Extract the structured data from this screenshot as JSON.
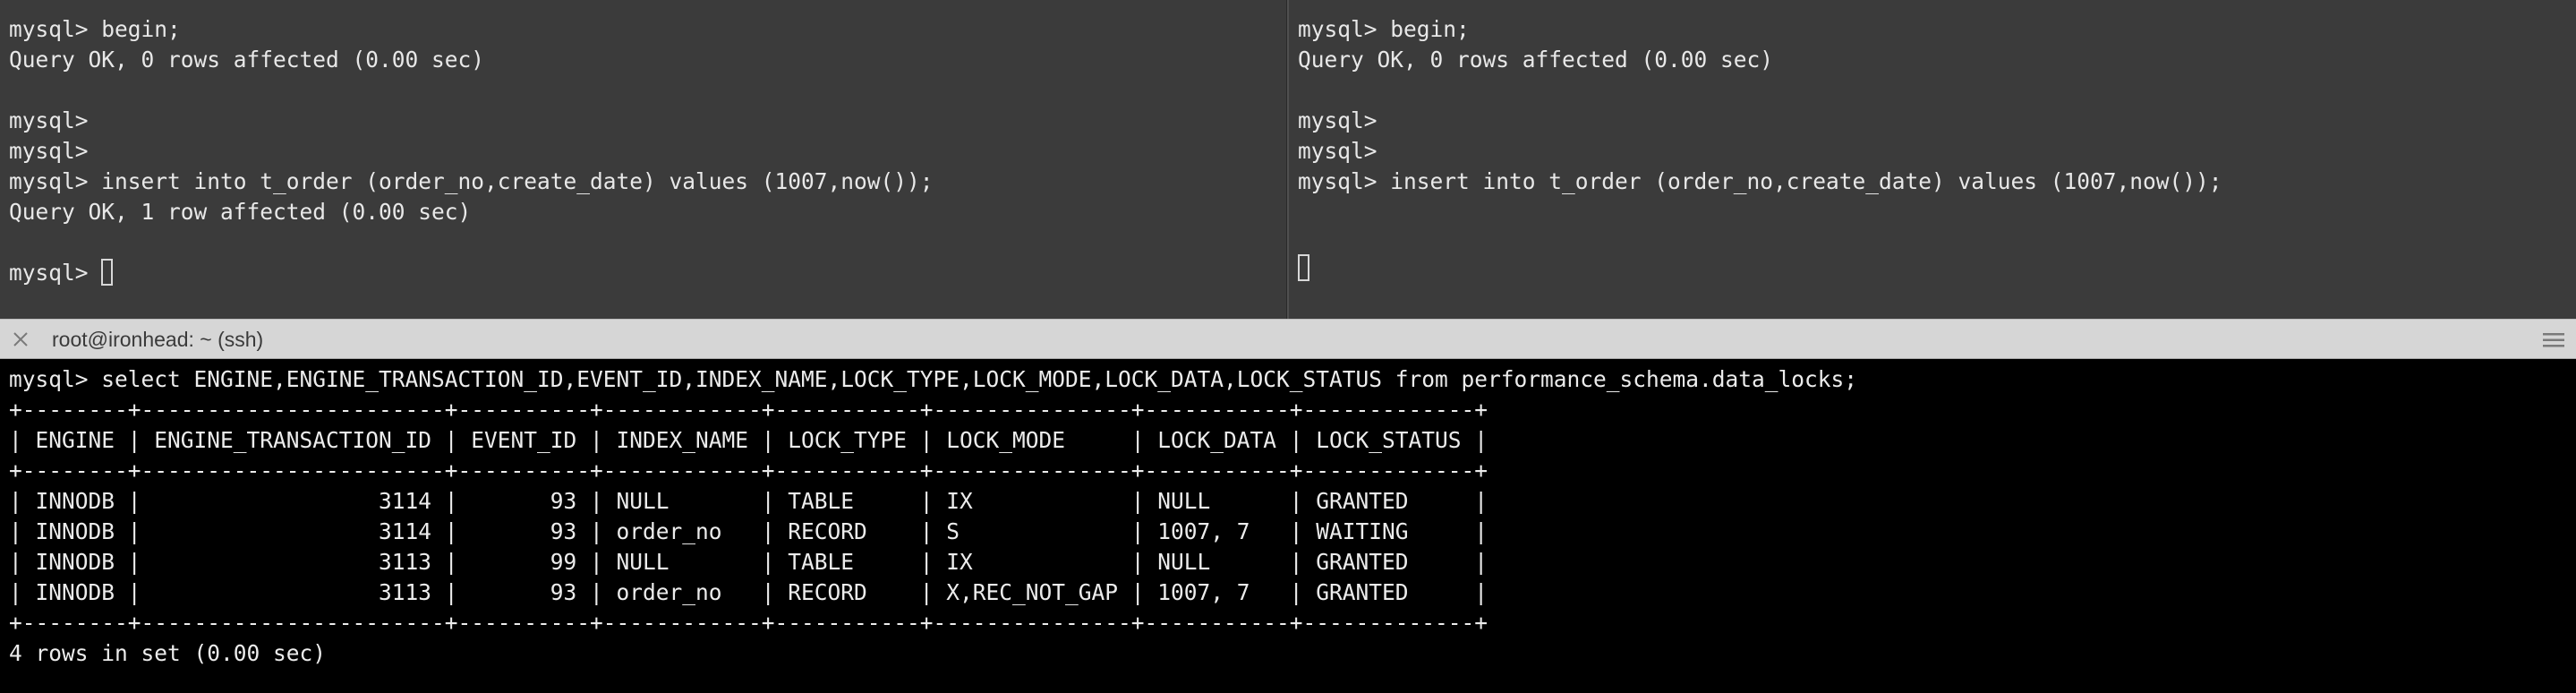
{
  "top_left_pane": {
    "lines": [
      "mysql> begin;",
      "Query OK, 0 rows affected (0.00 sec)",
      "",
      "mysql>",
      "mysql>",
      "mysql> insert into t_order (order_no,create_date) values (1007,now());",
      "Query OK, 1 row affected (0.00 sec)",
      "",
      "mysql> "
    ]
  },
  "top_right_pane": {
    "lines": [
      "mysql> begin;",
      "Query OK, 0 rows affected (0.00 sec)",
      "",
      "mysql>",
      "mysql>",
      "mysql> insert into t_order (order_no,create_date) values (1007,now());"
    ]
  },
  "title_bar": {
    "title": "root@ironhead: ~ (ssh)",
    "close_icon": "close-icon",
    "menu_icon": "hamburger-menu-icon",
    "background": "#d6d6d6"
  },
  "bottom_pane": {
    "lines": [
      "mysql> select ENGINE,ENGINE_TRANSACTION_ID,EVENT_ID,INDEX_NAME,LOCK_TYPE,LOCK_MODE,LOCK_DATA,LOCK_STATUS from performance_schema.data_locks;",
      "+--------+-----------------------+----------+------------+-----------+---------------+-----------+-------------+",
      "| ENGINE | ENGINE_TRANSACTION_ID | EVENT_ID | INDEX_NAME | LOCK_TYPE | LOCK_MODE     | LOCK_DATA | LOCK_STATUS |",
      "+--------+-----------------------+----------+------------+-----------+---------------+-----------+-------------+",
      "| INNODB |                  3114 |       93 | NULL       | TABLE     | IX            | NULL      | GRANTED     |",
      "| INNODB |                  3114 |       93 | order_no   | RECORD    | S             | 1007, 7   | WAITING     |",
      "| INNODB |                  3113 |       99 | NULL       | TABLE     | IX            | NULL      | GRANTED     |",
      "| INNODB |                  3113 |       93 | order_no   | RECORD    | X,REC_NOT_GAP | 1007, 7   | GRANTED     |",
      "+--------+-----------------------+----------+------------+-----------+---------------+-----------+-------------+",
      "4 rows in set (0.00 sec)"
    ]
  },
  "colors": {
    "top_pane_background": "#3b3b3b",
    "bottom_pane_background": "#000000",
    "text": "#e8e8e8"
  }
}
